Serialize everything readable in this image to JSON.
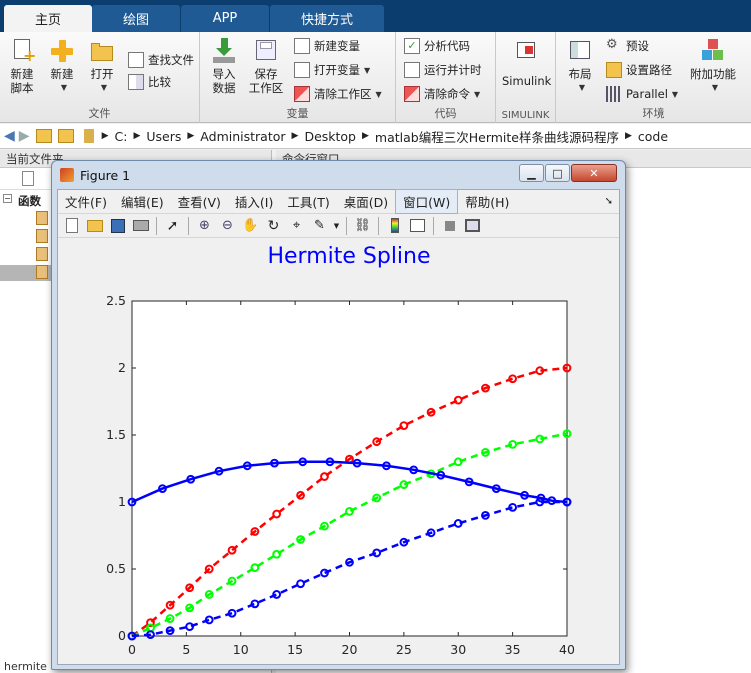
{
  "tabs": [
    {
      "label": "主页",
      "active": true
    },
    {
      "label": "绘图",
      "active": false
    },
    {
      "label": "APP",
      "active": false
    },
    {
      "label": "快捷方式",
      "active": false
    }
  ],
  "ribbon": {
    "file": {
      "group_label": "文件",
      "new_script": "新建\n脚本",
      "new": "新建",
      "open": "打开",
      "find_files": "查找文件",
      "compare": "比较"
    },
    "variable": {
      "group_label": "变量",
      "import_data": "导入\n数据",
      "save_workspace": "保存\n工作区",
      "new_variable": "新建变量",
      "open_variable": "打开变量",
      "clear_workspace": "清除工作区"
    },
    "code": {
      "group_label": "代码",
      "analyze_code": "分析代码",
      "run_time": "运行并计时",
      "clear_commands": "清除命令"
    },
    "simulink": {
      "group_label": "SIMULINK",
      "simulink": "Simulink"
    },
    "environment": {
      "group_label": "环境",
      "layout": "布局",
      "preferences": "预设",
      "set_path": "设置路径",
      "parallel": "Parallel",
      "addons": "附加功能"
    }
  },
  "address": {
    "path": [
      "C:",
      "Users",
      "Administrator",
      "Desktop",
      "matlab编程三次Hermite样条曲线源码程序",
      "code"
    ]
  },
  "left_panel": {
    "title": "当前文件夹",
    "section": "函数",
    "bottom_text": "hermite"
  },
  "right_panel": {
    "title": "命令行窗口"
  },
  "figure": {
    "title": "Figure 1",
    "menus": [
      "文件(F)",
      "编辑(E)",
      "查看(V)",
      "插入(I)",
      "工具(T)",
      "桌面(D)",
      "窗口(W)",
      "帮助(H)"
    ],
    "highlighted_menu": "窗口(W)"
  },
  "colors": {
    "red": "#ff0000",
    "green": "#00ff00",
    "blue": "#0000ff",
    "title_blue": "#0000ff",
    "tab_bar": "#0b3d6e"
  },
  "chart_data": {
    "type": "line",
    "title": "Hermite Spline",
    "xlabel": "",
    "ylabel": "",
    "xlim": [
      0,
      40
    ],
    "ylim": [
      0,
      2.5
    ],
    "xticks": [
      0,
      5,
      10,
      15,
      20,
      25,
      30,
      35,
      40
    ],
    "yticks": [
      0,
      0.5,
      1,
      1.5,
      2,
      2.5
    ],
    "ytick_labels": [
      "0",
      "0.5",
      "1",
      "1.5",
      "2",
      "2.5"
    ],
    "grid": false,
    "series": [
      {
        "color": "#ff0000",
        "line_style": "dashed",
        "marker": "circle",
        "x": [
          0,
          1.7,
          3.5,
          5.3,
          7.1,
          9.2,
          11.3,
          13.3,
          15.5,
          17.7,
          20,
          22.5,
          25,
          27.5,
          30,
          32.5,
          35,
          37.5,
          40
        ],
        "y": [
          0,
          0.1,
          0.23,
          0.36,
          0.5,
          0.64,
          0.78,
          0.91,
          1.05,
          1.19,
          1.32,
          1.45,
          1.57,
          1.67,
          1.76,
          1.85,
          1.92,
          1.98,
          2.0
        ]
      },
      {
        "color": "#00ff00",
        "line_style": "dashed",
        "marker": "circle",
        "x": [
          0,
          1.7,
          3.5,
          5.3,
          7.1,
          9.2,
          11.3,
          13.3,
          15.5,
          17.7,
          20,
          22.5,
          25,
          27.5,
          30,
          32.5,
          35,
          37.5,
          40
        ],
        "y": [
          0,
          0.06,
          0.13,
          0.21,
          0.31,
          0.41,
          0.51,
          0.61,
          0.72,
          0.82,
          0.93,
          1.03,
          1.13,
          1.21,
          1.3,
          1.37,
          1.43,
          1.47,
          1.51
        ]
      },
      {
        "color": "#0000ff",
        "line_style": "dashed",
        "marker": "circle",
        "x": [
          0,
          1.7,
          3.5,
          5.3,
          7.1,
          9.2,
          11.3,
          13.3,
          15.5,
          17.7,
          20,
          22.5,
          25,
          27.5,
          30,
          32.5,
          35,
          37.5,
          40
        ],
        "y": [
          0,
          0.01,
          0.04,
          0.07,
          0.12,
          0.17,
          0.24,
          0.31,
          0.39,
          0.47,
          0.55,
          0.62,
          0.7,
          0.77,
          0.84,
          0.9,
          0.96,
          1.0,
          1.0
        ]
      },
      {
        "color": "#0000ff",
        "line_style": "solid",
        "marker": "circle",
        "x": [
          0,
          2.8,
          5.4,
          8,
          10.6,
          13.1,
          15.7,
          18.2,
          20.7,
          23.4,
          25.9,
          28.4,
          31,
          33.5,
          36.1,
          37.6,
          38.6,
          40
        ],
        "y": [
          1.0,
          1.1,
          1.17,
          1.23,
          1.27,
          1.29,
          1.3,
          1.3,
          1.29,
          1.27,
          1.24,
          1.2,
          1.15,
          1.1,
          1.05,
          1.03,
          1.01,
          1.0
        ]
      }
    ]
  }
}
